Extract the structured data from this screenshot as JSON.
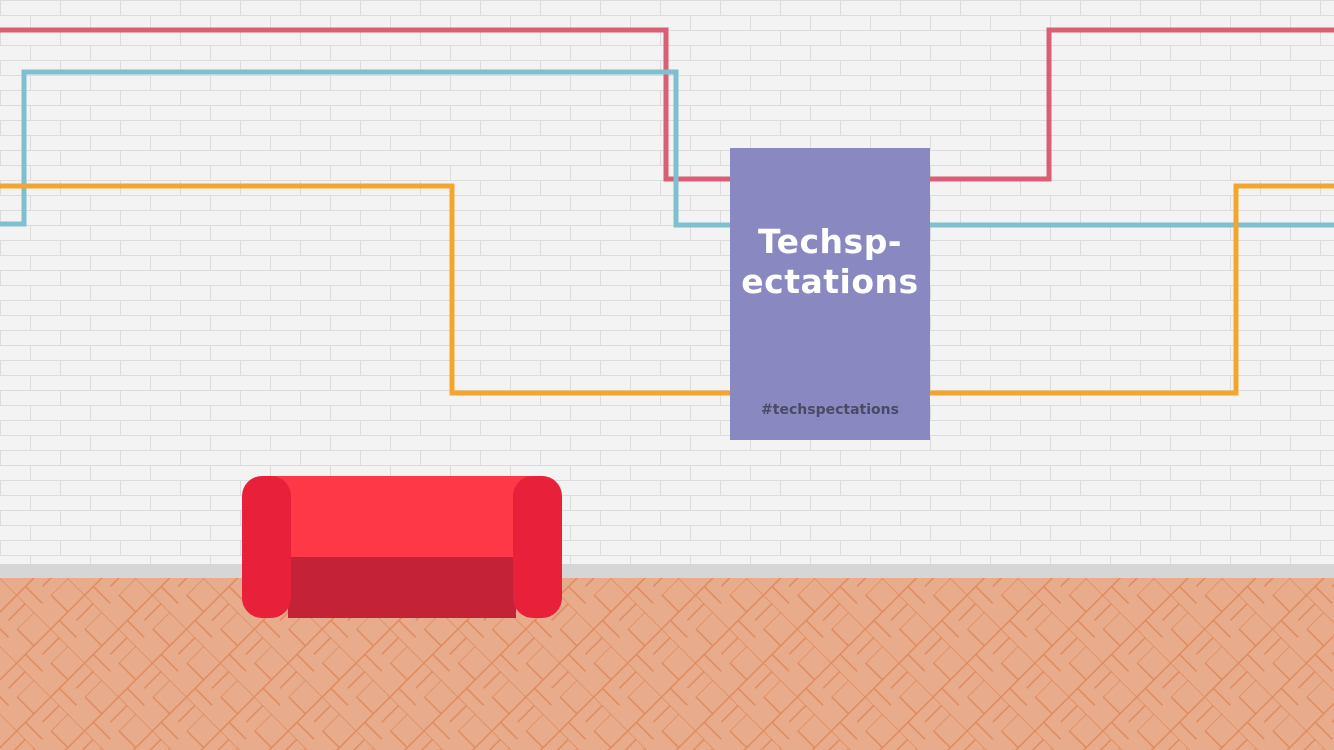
{
  "poster": {
    "title_line1": "Techsp-",
    "title_line2": "ectations",
    "hashtag": "#techspectations"
  },
  "colors": {
    "wall": "#f3f3f3",
    "brick_line": "#dcdcdc",
    "baseboard": "#d6d6d6",
    "floor": "#e8ac8d",
    "floor_line": "#e08a5c",
    "line_pink": "#d95f75",
    "line_blue": "#7fbfcf",
    "line_orange": "#f3a62f",
    "poster": "#8988c0",
    "couch_back": "#ff3848",
    "couch_arm": "#e8203a",
    "couch_seat": "#c42236"
  }
}
